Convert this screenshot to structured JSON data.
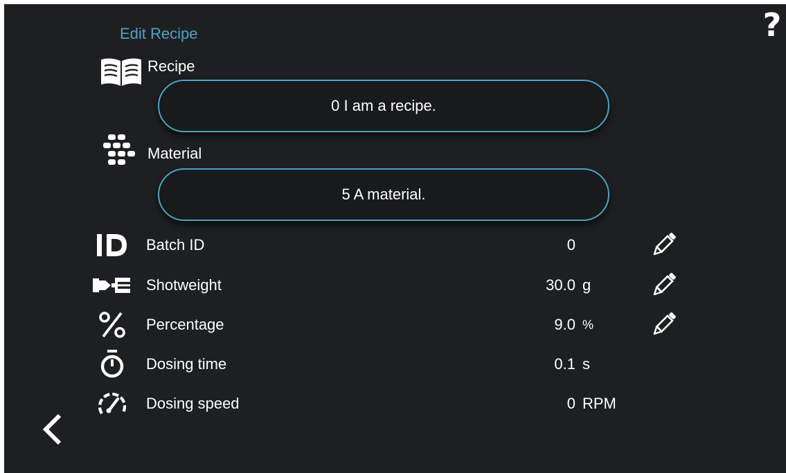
{
  "header": {
    "title": "Edit Recipe",
    "help_label": "?"
  },
  "recipe": {
    "label": "Recipe",
    "value": "0 I am a recipe."
  },
  "material": {
    "label": "Material",
    "value": "5 A material."
  },
  "rows": [
    {
      "label": "Batch ID",
      "value": "0",
      "unit": "",
      "icon": "id-icon",
      "editable": true
    },
    {
      "label": "Shotweight",
      "value": "30.0",
      "unit": "g",
      "icon": "shotweight-icon",
      "editable": true
    },
    {
      "label": "Percentage",
      "value": "9.0",
      "unit": "%",
      "icon": "percent-icon",
      "editable": true
    },
    {
      "label": "Dosing time",
      "value": "0.1",
      "unit": "s",
      "icon": "stopwatch-icon",
      "editable": false
    },
    {
      "label": "Dosing speed",
      "value": "0",
      "unit": "RPM",
      "icon": "speedometer-icon",
      "editable": false
    }
  ],
  "colors": {
    "accent": "#4da3c9",
    "background": "#1d1f20",
    "text": "#ffffff"
  }
}
